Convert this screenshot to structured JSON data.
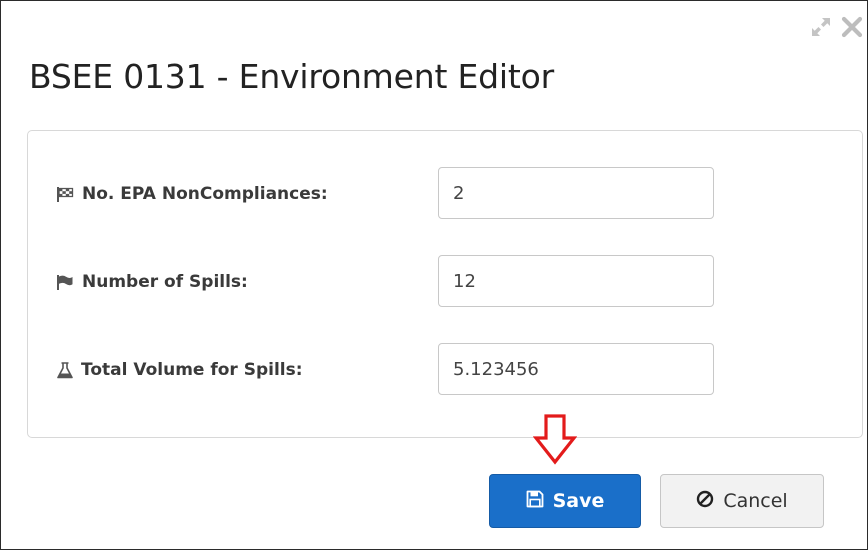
{
  "dialog": {
    "title": "BSEE 0131 - Environment Editor"
  },
  "form": {
    "fields": [
      {
        "label": "No. EPA NonCompliances:",
        "value": "2",
        "icon": "flag-checkered-icon"
      },
      {
        "label": "Number of Spills:",
        "value": "12",
        "icon": "flag-icon"
      },
      {
        "label": "Total Volume for Spills:",
        "value": "5.123456",
        "icon": "flask-icon"
      }
    ]
  },
  "buttons": {
    "save_label": "Save",
    "cancel_label": "Cancel"
  },
  "colors": {
    "primary": "#1a6fc9",
    "annotation_arrow": "#e31b1b"
  }
}
